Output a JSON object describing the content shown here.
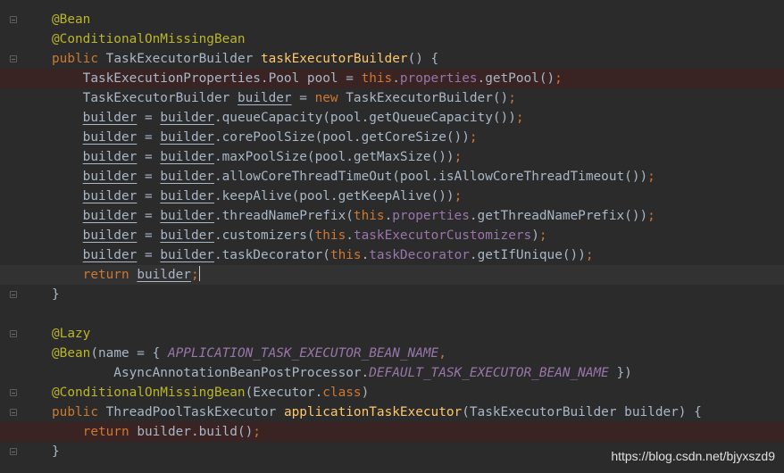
{
  "editor": {
    "lines": [
      [
        [
          "ann",
          "@Bean"
        ]
      ],
      [
        [
          "ann",
          "@ConditionalOnMissingBean"
        ]
      ],
      [
        [
          "kw",
          "public "
        ],
        [
          "",
          "TaskExecutorBuilder "
        ],
        [
          "fn",
          "taskExecutorBuilder"
        ],
        [
          "",
          "() {"
        ]
      ],
      [
        [
          "",
          "    TaskExecutionProperties.Pool pool = "
        ],
        [
          "kw",
          "this"
        ],
        [
          "",
          "."
        ],
        [
          "fld",
          "properties"
        ],
        [
          "",
          ".getPool()"
        ],
        [
          "kw",
          ";"
        ]
      ],
      [
        [
          "",
          "    TaskExecutorBuilder "
        ],
        [
          "und",
          "builder"
        ],
        [
          "",
          " = "
        ],
        [
          "kw",
          "new "
        ],
        [
          "",
          "TaskExecutorBuilder()"
        ],
        [
          "kw",
          ";"
        ]
      ],
      [
        [
          "",
          "    "
        ],
        [
          "und",
          "builder"
        ],
        [
          "",
          " = "
        ],
        [
          "und",
          "builder"
        ],
        [
          "",
          ".queueCapacity(pool.getQueueCapacity())"
        ],
        [
          "kw",
          ";"
        ]
      ],
      [
        [
          "",
          "    "
        ],
        [
          "und",
          "builder"
        ],
        [
          "",
          " = "
        ],
        [
          "und",
          "builder"
        ],
        [
          "",
          ".corePoolSize(pool.getCoreSize())"
        ],
        [
          "kw",
          ";"
        ]
      ],
      [
        [
          "",
          "    "
        ],
        [
          "und",
          "builder"
        ],
        [
          "",
          " = "
        ],
        [
          "und",
          "builder"
        ],
        [
          "",
          ".maxPoolSize(pool.getMaxSize())"
        ],
        [
          "kw",
          ";"
        ]
      ],
      [
        [
          "",
          "    "
        ],
        [
          "und",
          "builder"
        ],
        [
          "",
          " = "
        ],
        [
          "und",
          "builder"
        ],
        [
          "",
          ".allowCoreThreadTimeOut(pool.isAllowCoreThreadTimeout())"
        ],
        [
          "kw",
          ";"
        ]
      ],
      [
        [
          "",
          "    "
        ],
        [
          "und",
          "builder"
        ],
        [
          "",
          " = "
        ],
        [
          "und",
          "builder"
        ],
        [
          "",
          ".keepAlive(pool.getKeepAlive())"
        ],
        [
          "kw",
          ";"
        ]
      ],
      [
        [
          "",
          "    "
        ],
        [
          "und",
          "builder"
        ],
        [
          "",
          " = "
        ],
        [
          "und",
          "builder"
        ],
        [
          "",
          ".threadNamePrefix("
        ],
        [
          "kw",
          "this"
        ],
        [
          "",
          "."
        ],
        [
          "fld",
          "properties"
        ],
        [
          "",
          ".getThreadNamePrefix())"
        ],
        [
          "kw",
          ";"
        ]
      ],
      [
        [
          "",
          "    "
        ],
        [
          "und",
          "builder"
        ],
        [
          "",
          " = "
        ],
        [
          "und",
          "builder"
        ],
        [
          "",
          ".customizers("
        ],
        [
          "kw",
          "this"
        ],
        [
          "",
          "."
        ],
        [
          "fld",
          "taskExecutorCustomizers"
        ],
        [
          "",
          ")"
        ],
        [
          "kw",
          ";"
        ]
      ],
      [
        [
          "",
          "    "
        ],
        [
          "und",
          "builder"
        ],
        [
          "",
          " = "
        ],
        [
          "und",
          "builder"
        ],
        [
          "",
          ".taskDecorator("
        ],
        [
          "kw",
          "this"
        ],
        [
          "",
          "."
        ],
        [
          "fld",
          "taskDecorator"
        ],
        [
          "",
          ".getIfUnique())"
        ],
        [
          "kw",
          ";"
        ]
      ],
      [
        [
          "kw",
          "    return "
        ],
        [
          "und",
          "builder"
        ],
        [
          "kw",
          ";"
        ],
        [
          "caret",
          ""
        ]
      ],
      [
        [
          "",
          "}"
        ]
      ],
      [],
      [
        [
          "ann",
          "@Lazy"
        ]
      ],
      [
        [
          "ann",
          "@Bean"
        ],
        [
          "",
          "(name = { "
        ],
        [
          "ifld",
          "APPLICATION_TASK_EXECUTOR_BEAN_NAME"
        ],
        [
          "kw",
          ","
        ]
      ],
      [
        [
          "",
          "        AsyncAnnotationBeanPostProcessor."
        ],
        [
          "ifld",
          "DEFAULT_TASK_EXECUTOR_BEAN_NAME"
        ],
        [
          "",
          " })"
        ]
      ],
      [
        [
          "ann",
          "@ConditionalOnMissingBean"
        ],
        [
          "",
          "(Executor."
        ],
        [
          "kw",
          "class"
        ],
        [
          "",
          ")"
        ]
      ],
      [
        [
          "kw",
          "public "
        ],
        [
          "",
          "ThreadPoolTaskExecutor "
        ],
        [
          "fn",
          "applicationTaskExecutor"
        ],
        [
          "",
          "(TaskExecutorBuilder builder) {"
        ]
      ],
      [
        [
          "kw",
          "    return "
        ],
        [
          "",
          "builder.build()"
        ],
        [
          "kw",
          ";"
        ]
      ],
      [
        [
          "",
          "}"
        ]
      ]
    ]
  },
  "watermark": "https://blog.csdn.net/bjyxszd9"
}
